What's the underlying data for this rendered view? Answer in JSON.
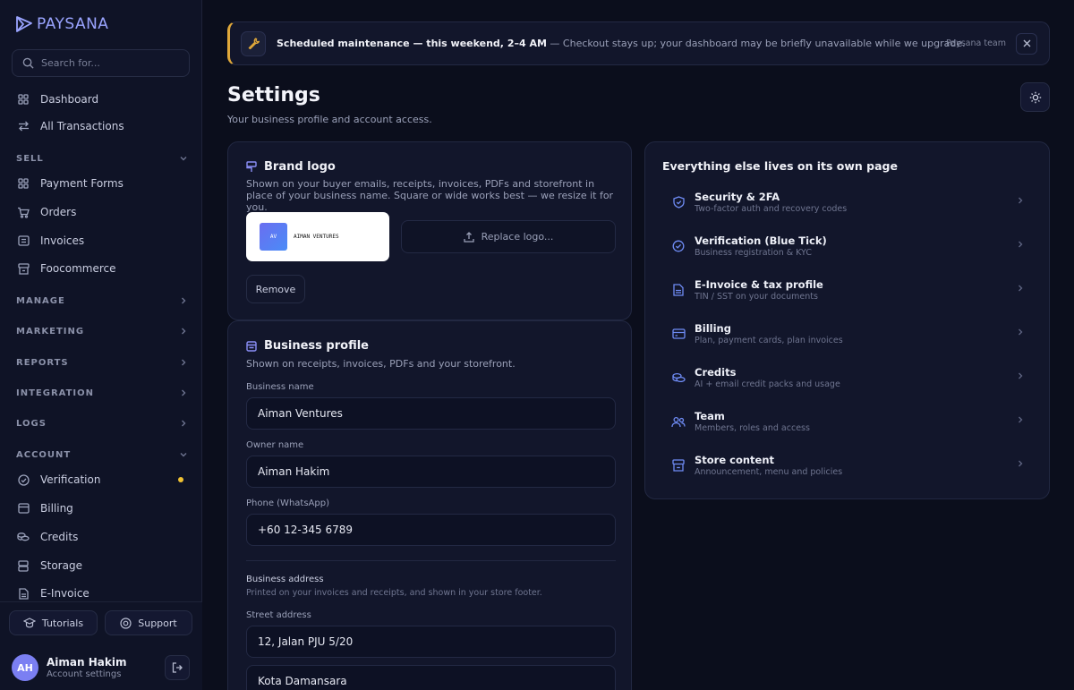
{
  "brand": {
    "name": "PAYSANA"
  },
  "search": {
    "placeholder": "Search for..."
  },
  "nav": {
    "top": [
      {
        "label": "Dashboard",
        "icon": "grid-icon"
      },
      {
        "label": "All Transactions",
        "icon": "swap-arrows-icon"
      }
    ],
    "sell": {
      "label": "SELL",
      "items": [
        {
          "label": "Payment Forms",
          "icon": "grid-icon"
        },
        {
          "label": "Orders",
          "icon": "cart-icon"
        },
        {
          "label": "Invoices",
          "icon": "invoice-icon"
        },
        {
          "label": "Foocommerce",
          "icon": "storefront-icon"
        }
      ]
    },
    "collapsed_sections": [
      "MANAGE",
      "MARKETING",
      "REPORTS",
      "INTEGRATION",
      "LOGS"
    ],
    "account": {
      "label": "ACCOUNT",
      "items": [
        {
          "label": "Verification",
          "icon": "badge-check-icon",
          "notification": true
        },
        {
          "label": "Billing",
          "icon": "credit-card-icon"
        },
        {
          "label": "Credits",
          "icon": "coins-icon"
        },
        {
          "label": "Storage",
          "icon": "database-icon"
        },
        {
          "label": "E-Invoice",
          "icon": "file-icon"
        }
      ]
    }
  },
  "footer": {
    "tutorials_label": "Tutorials",
    "support_label": "Support",
    "user": {
      "initials": "AH",
      "name": "Aiman Hakim",
      "subtitle": "Account settings"
    }
  },
  "banner": {
    "title": "Scheduled maintenance — this weekend, 2–4 AM",
    "message": " — Checkout stays up; your dashboard may be briefly unavailable while we upgrade.",
    "author": "Paysana team",
    "accent_color": "#e0a83a"
  },
  "page": {
    "title": "Settings",
    "subtitle": "Your business profile and account access."
  },
  "brand_logo": {
    "title": "Brand logo",
    "description": "Shown on your buyer emails, receipts, invoices, PDFs and storefront in place of your business name. Square or wide works best — we resize it for you.",
    "logo_mark": "AV",
    "logo_text": "AIMAN VENTURES",
    "replace_label": "Replace logo...",
    "remove_label": "Remove"
  },
  "business_profile": {
    "title": "Business profile",
    "description": "Shown on receipts, invoices, PDFs and your storefront.",
    "fields": {
      "business_name": {
        "label": "Business name",
        "value": "Aiman Ventures"
      },
      "owner_name": {
        "label": "Owner name",
        "value": "Aiman Hakim"
      },
      "phone": {
        "label": "Phone (WhatsApp)",
        "value": "+60 12-345 6789"
      }
    },
    "address": {
      "heading": "Business address",
      "description": "Printed on your invoices and receipts, and shown in your store footer.",
      "street_label": "Street address",
      "street_value": "12, Jalan PJU 5/20",
      "city_value": "Kota Damansara"
    }
  },
  "links_card": {
    "title": "Everything else lives on its own page",
    "items": [
      {
        "title": "Security & 2FA",
        "desc": "Two-factor auth and recovery codes",
        "icon": "shield-icon"
      },
      {
        "title": "Verification (Blue Tick)",
        "desc": "Business registration & KYC",
        "icon": "badge-check-icon"
      },
      {
        "title": "E-Invoice & tax profile",
        "desc": "TIN / SST on your documents",
        "icon": "file-icon"
      },
      {
        "title": "Billing",
        "desc": "Plan, payment cards, plan invoices",
        "icon": "credit-card-icon"
      },
      {
        "title": "Credits",
        "desc": "AI + email credit packs and usage",
        "icon": "coins-icon"
      },
      {
        "title": "Team",
        "desc": "Members, roles and access",
        "icon": "users-icon"
      },
      {
        "title": "Store content",
        "desc": "Announcement, menu and policies",
        "icon": "store-icon"
      }
    ]
  }
}
